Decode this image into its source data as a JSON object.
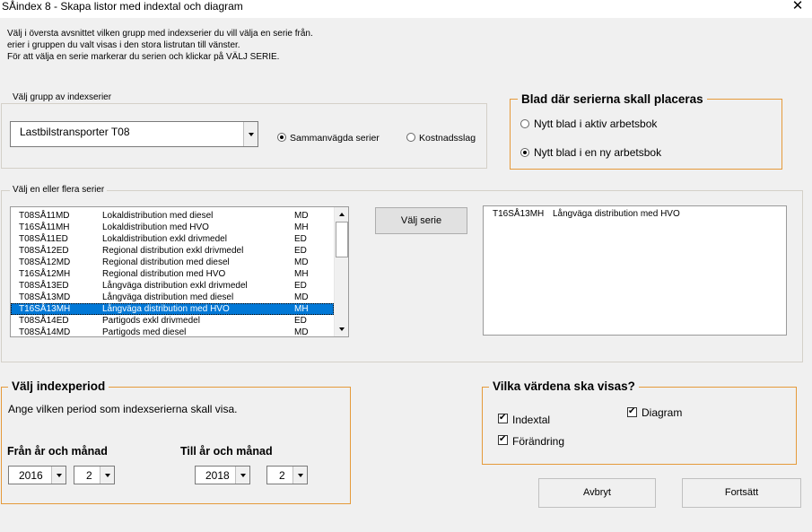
{
  "window": {
    "title": "SÅindex 8 - Skapa listor med indextal och diagram",
    "close_glyph": "✕"
  },
  "intro_lines": [
    "Välj i översta avsnittet vilken grupp med indexserier du vill välja en serie från.",
    "erier i gruppen du valt visas i den stora listrutan till vänster.",
    "För att välja en serie markerar du serien och klickar på VÄLJ SERIE."
  ],
  "group_select": {
    "legend": "Välj grupp av indexserier",
    "combo_value": "Lastbilstransporter T08",
    "radio_weighted": "Sammanvägda serier",
    "radio_cost": "Kostnadsslag",
    "selected": "weighted"
  },
  "sheet_placement": {
    "legend": "Blad där serierna skall placeras",
    "option_active": "Nytt blad i aktiv arbetsbok",
    "option_new": "Nytt blad i en ny arbetsbok",
    "selected": "new"
  },
  "series_select": {
    "legend": "Välj en eller flera serier",
    "items": [
      {
        "code": "T08SÅ11MD",
        "desc": "Lokaldistribution med diesel",
        "type": "MD"
      },
      {
        "code": "T16SÅ11MH",
        "desc": "Lokaldistribution med HVO",
        "type": "MH"
      },
      {
        "code": "T08SÅ11ED",
        "desc": "Lokaldistribution exkl drivmedel",
        "type": "ED"
      },
      {
        "code": "T08SÅ12ED",
        "desc": "Regional distribution exkl drivmedel",
        "type": "ED"
      },
      {
        "code": "T08SÅ12MD",
        "desc": "Regional distribution med diesel",
        "type": "MD"
      },
      {
        "code": "T16SÅ12MH",
        "desc": "Regional distribution med HVO",
        "type": "MH"
      },
      {
        "code": "T08SÅ13ED",
        "desc": "Långväga distribution exkl drivmedel",
        "type": "ED"
      },
      {
        "code": "T08SÅ13MD",
        "desc": "Långväga distribution med diesel",
        "type": "MD"
      },
      {
        "code": "T16SÅ13MH",
        "desc": "Långväga distribution med HVO",
        "type": "MH"
      },
      {
        "code": "T08SÅ14ED",
        "desc": "Partigods exkl drivmedel",
        "type": "ED"
      },
      {
        "code": "T08SÅ14MD",
        "desc": "Partigods med diesel",
        "type": "MD"
      }
    ],
    "selected_index": 8,
    "select_button": "Välj serie",
    "chosen": [
      {
        "code": "T16SÅ13MH",
        "desc": "Långväga distribution med HVO"
      }
    ]
  },
  "period": {
    "legend": "Välj indexperiod",
    "instruction": "Ange vilken period som indexserierna skall visa.",
    "from_label": "Från år och månad",
    "to_label": "Till år och månad",
    "from_year": "2016",
    "from_month": "2",
    "to_year": "2018",
    "to_month": "2"
  },
  "display": {
    "legend": "Vilka värdena ska visas?",
    "indextal": "Indextal",
    "forandring": "Förändring",
    "diagram": "Diagram",
    "indextal_checked": true,
    "forandring_checked": true,
    "diagram_checked": true
  },
  "buttons": {
    "cancel": "Avbryt",
    "continue": "Fortsätt"
  }
}
